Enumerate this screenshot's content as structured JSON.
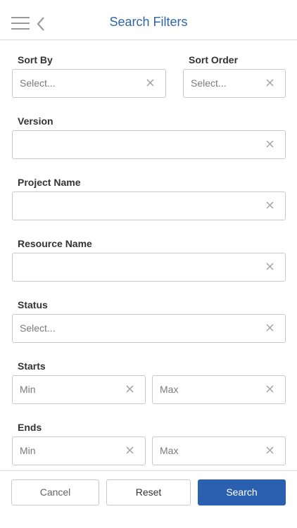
{
  "header": {
    "title": "Search Filters"
  },
  "filters": {
    "sort_by": {
      "label": "Sort By",
      "placeholder": "Select..."
    },
    "sort_order": {
      "label": "Sort Order",
      "placeholder": "Select..."
    },
    "version": {
      "label": "Version",
      "placeholder": ""
    },
    "project_name": {
      "label": "Project Name",
      "placeholder": ""
    },
    "resource_name": {
      "label": "Resource Name",
      "placeholder": ""
    },
    "status": {
      "label": "Status",
      "placeholder": "Select..."
    },
    "starts": {
      "label": "Starts",
      "min_placeholder": "Min",
      "max_placeholder": "Max"
    },
    "ends": {
      "label": "Ends",
      "min_placeholder": "Min",
      "max_placeholder": "Max"
    }
  },
  "footer": {
    "cancel_label": "Cancel",
    "reset_label": "Reset",
    "search_label": "Search"
  },
  "colors": {
    "accent": "#2b5fb0",
    "title": "#2f65a8",
    "border": "#c9c9c9"
  }
}
